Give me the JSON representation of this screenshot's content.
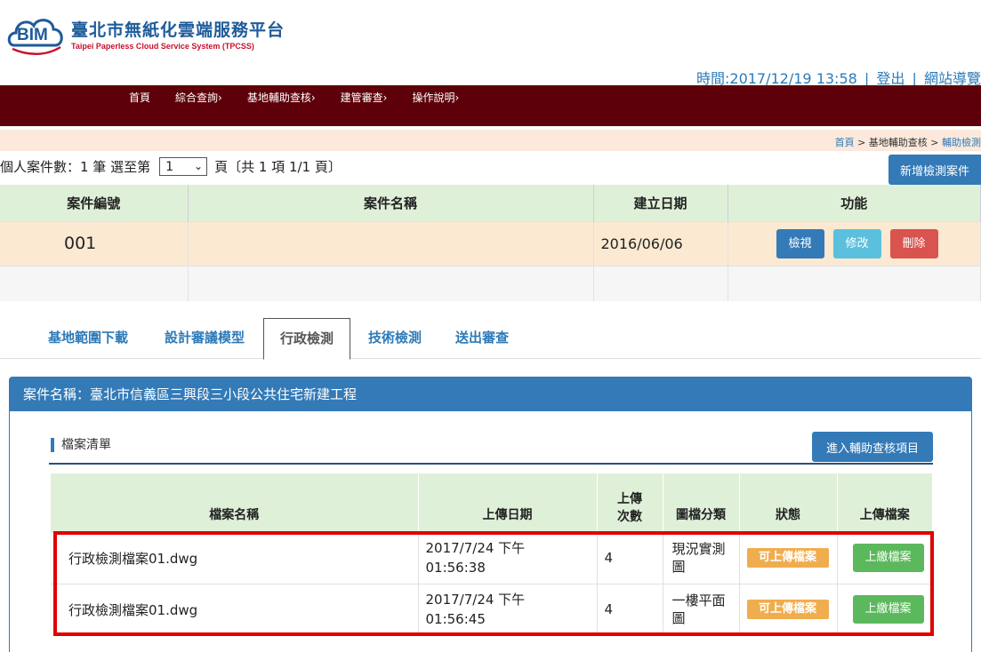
{
  "header": {
    "logo_badge": "BIM",
    "title": "臺北市無紙化雲端服務平台",
    "subtitle": "Taipei Paperless Cloud Service System (TPCSS)",
    "time": "時間:2017/12/19 13:58",
    "logout": "登出",
    "sitemap": "網站導覽",
    "separator": "|"
  },
  "nav": {
    "items": [
      "首頁",
      "綜合查詢›",
      "基地輔助查核›",
      "建管審查›",
      "操作說明›"
    ]
  },
  "breadcrumb": {
    "home": "首頁",
    "sep": ">",
    "level2": "基地輔助查核",
    "level3": "輔助檢測"
  },
  "pager": {
    "prefix": "個人案件數：1 筆 選至第",
    "page_value": "1",
    "suffix": "頁〔共 1 項 1/1 頁〕"
  },
  "buttons": {
    "new_case": "新增檢測案件",
    "view": "檢視",
    "edit": "修改",
    "delete": "刪除",
    "enter_items": "進入輔助查核項目"
  },
  "cases_table": {
    "headers": [
      "案件編號",
      "案件名稱",
      "建立日期",
      "功能"
    ],
    "rows": [
      {
        "no": "001",
        "name": "",
        "date": "2016/06/06"
      }
    ]
  },
  "tabs": [
    "基地範圍下載",
    "設計審議模型",
    "行政檢測",
    "技術檢測",
    "送出審查"
  ],
  "active_tab": "行政檢測",
  "panel": {
    "heading": "案件名稱：臺北市信義區三興段三小段公共住宅新建工程",
    "section_title": "檔案清單"
  },
  "files_table": {
    "headers": [
      "檔案名稱",
      "上傳日期",
      "上傳次數",
      "圖檔分類",
      "狀態",
      "上傳檔案"
    ],
    "rows": [
      {
        "name": "行政檢測檔案01.dwg",
        "date_line1": "2017/7/24 下午",
        "date_line2": "01:56:38",
        "count": "4",
        "category_line1": "現況實測",
        "category_line2": "圖",
        "status": "可上傳檔案",
        "action": "上繳檔案"
      },
      {
        "name": "行政檢測檔案01.dwg",
        "date_line1": "2017/7/24 下午",
        "date_line2": "01:56:45",
        "count": "4",
        "category_line1": "一樓平面",
        "category_line2": "圖",
        "status": "可上傳檔案",
        "action": "上繳檔案"
      }
    ]
  },
  "colors": {
    "nav_bg": "#5e0009",
    "primary": "#337ab7",
    "success": "#5cb85c",
    "warning": "#f0ad4e",
    "danger": "#d9534f",
    "info": "#5bc0de",
    "highlight_box": "#e00000"
  }
}
